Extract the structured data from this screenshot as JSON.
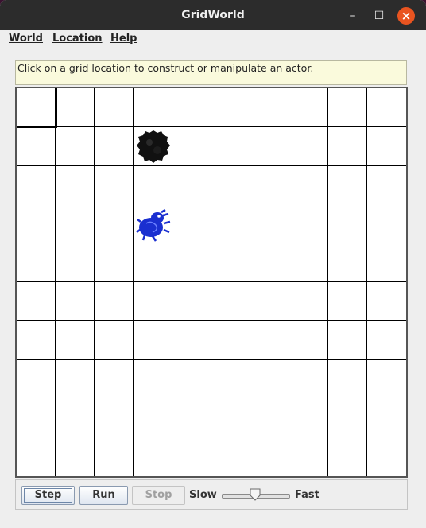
{
  "window": {
    "title": "GridWorld"
  },
  "menu": {
    "world": "World",
    "location": "Location",
    "help": "Help"
  },
  "status_message": "Click on a grid location to construct or manipulate an actor.",
  "grid": {
    "rows": 10,
    "cols": 10,
    "selected_cell": {
      "row": 0,
      "col": 0
    },
    "actors": [
      {
        "name": "rock",
        "icon": "rock-icon",
        "row": 1,
        "col": 3,
        "color": "#111111"
      },
      {
        "name": "bug",
        "icon": "bug-icon",
        "row": 3,
        "col": 3,
        "color": "#1a2fd0"
      }
    ]
  },
  "controls": {
    "step": "Step",
    "run": "Run",
    "stop": "Stop",
    "slow": "Slow",
    "fast": "Fast",
    "speed_slider_value": 0.5
  }
}
